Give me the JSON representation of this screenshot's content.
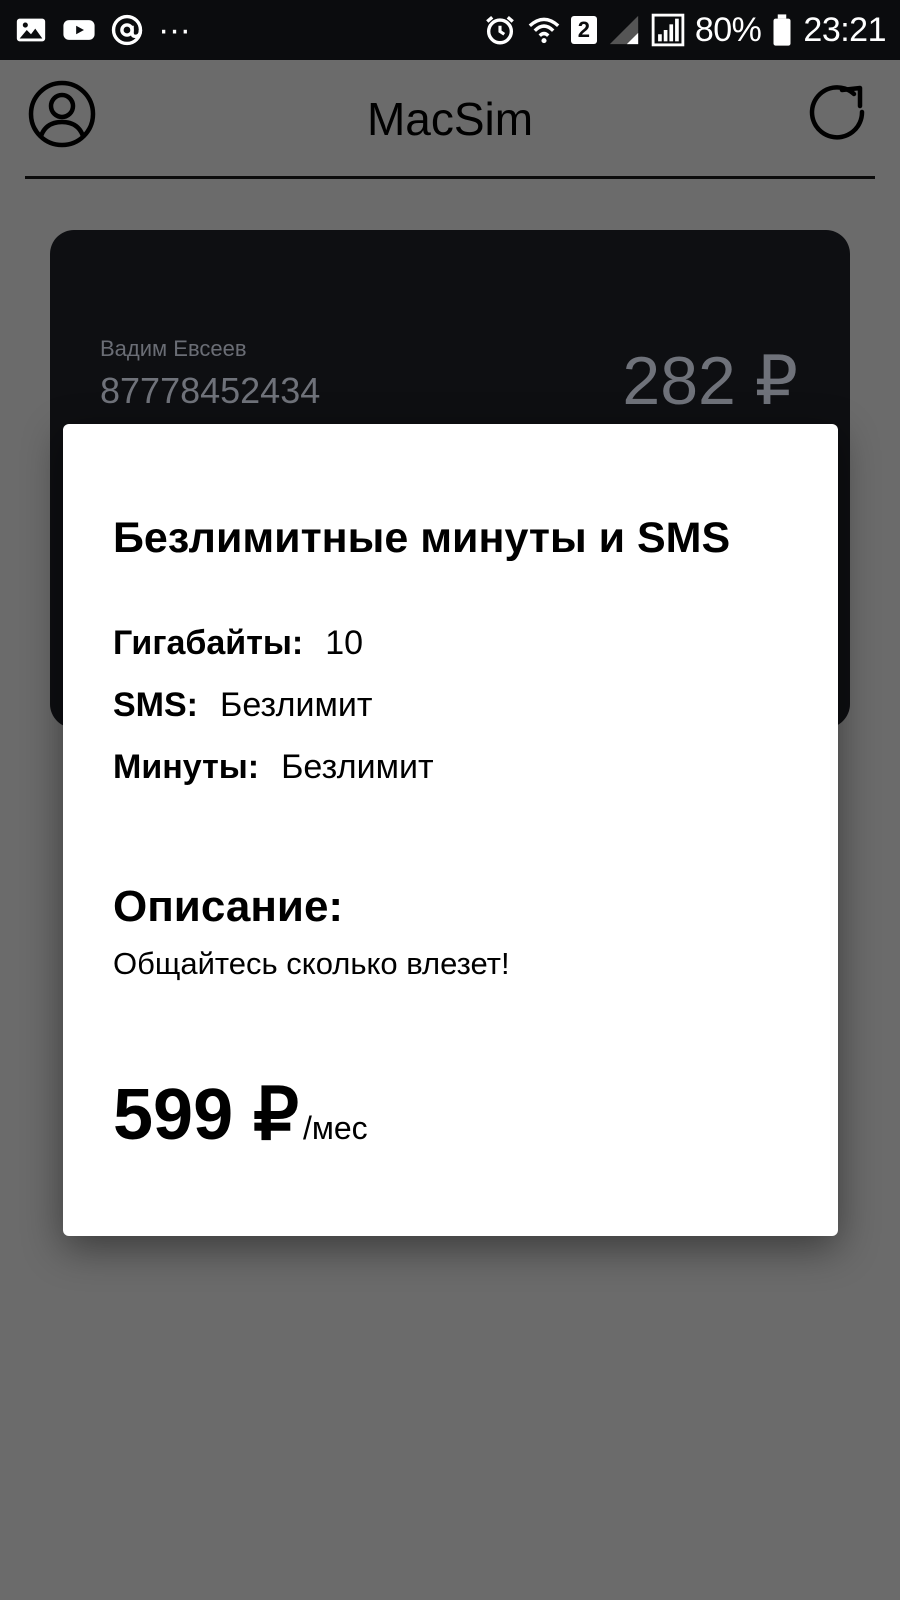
{
  "status_bar": {
    "left_icons": [
      "gallery-icon",
      "youtube-icon",
      "at-sign-icon",
      "more-dots-icon"
    ],
    "more_dots": "···",
    "right_icons": [
      "alarm-icon",
      "wifi-icon",
      "sim-badge-icon",
      "signal-icon",
      "signal-icon",
      "battery-icon"
    ],
    "sim_badge": "2",
    "battery_percent": "80%",
    "time": "23:21"
  },
  "app_bar": {
    "title": "MacSim",
    "profile_icon": "user-circle-icon",
    "refresh_icon": "refresh-icon"
  },
  "account_card": {
    "name": "Вадим Евсеев",
    "phone": "87778452434",
    "balance": "282 ₽"
  },
  "plan_modal": {
    "title": "Безлимитные минуты и SMS",
    "specs": [
      {
        "label": "Гигабайты:",
        "value": "10"
      },
      {
        "label": "SMS:",
        "value": "Безлимит"
      },
      {
        "label": "Минуты:",
        "value": "Безлимит"
      }
    ],
    "description_heading": "Описание:",
    "description_text": "Общайтесь сколько влезет!",
    "price_amount": "599 ₽",
    "price_period": "/мес"
  },
  "colors": {
    "status_bar_bg": "#0b0c0e",
    "overlay_bg": "#6b6b6b",
    "card_bg": "#0e0f12",
    "card_text": "#6f727a",
    "modal_bg": "#ffffff"
  }
}
